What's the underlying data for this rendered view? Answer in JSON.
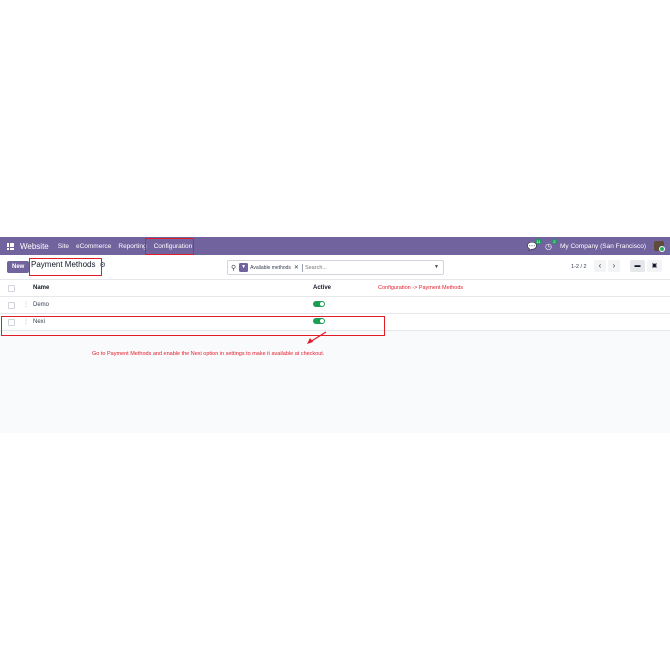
{
  "navbar": {
    "app_name": "Website",
    "menu": [
      "Site",
      "eCommerce",
      "Reporting",
      "Configuration"
    ],
    "messages_badge": "11",
    "activities_badge": "2",
    "company": "My Company (San Francisco)"
  },
  "control": {
    "new_label": "New",
    "breadcrumb": "Payment Methods",
    "search_facet": "Available methods",
    "search_placeholder": "Search...",
    "pager": "1-2 / 2"
  },
  "list": {
    "headers": {
      "name": "Name",
      "active": "Active"
    },
    "rows": [
      {
        "name": "Demo",
        "active": true
      },
      {
        "name": "Nexi",
        "active": true
      }
    ]
  },
  "annotations": {
    "config_note": "Configuration -> Payment Methods",
    "instruction": "Go to Payment Methods and enable the Nexi option in settings to make it available at checkout.",
    "color": "#e11d2a"
  },
  "colors": {
    "brand": "#71639e",
    "toggle_on": "#1aa055"
  }
}
